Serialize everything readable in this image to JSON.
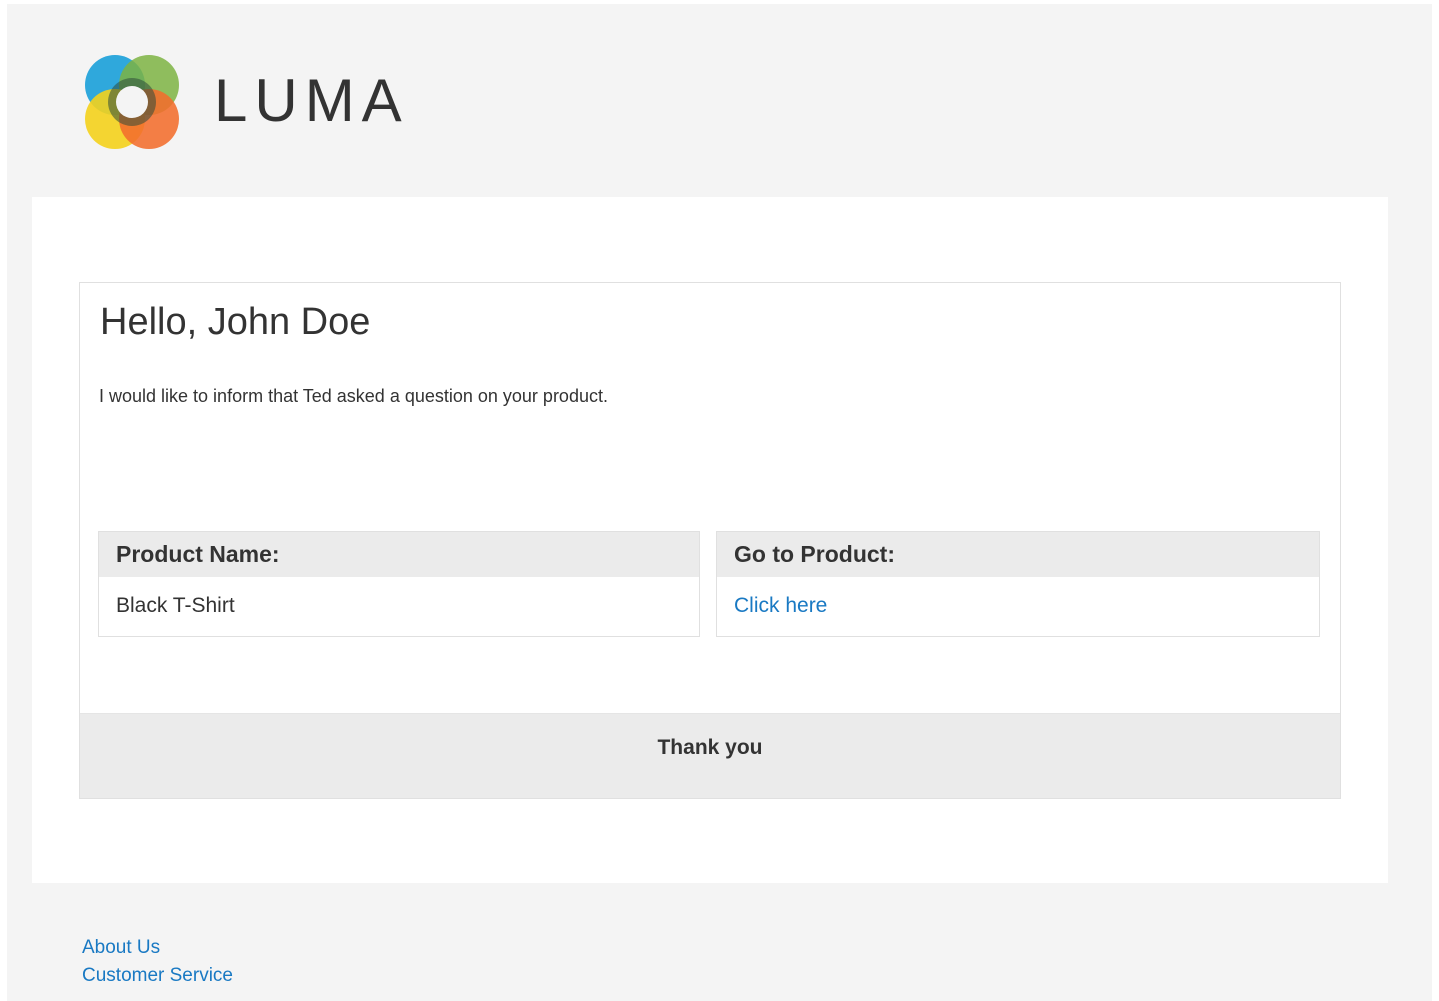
{
  "header": {
    "logo_text": "LUMA",
    "logo_icon": "luma-logo-icon"
  },
  "message": {
    "greeting": "Hello, John Doe",
    "intro": "I would like to inform that Ted asked a question on your product.",
    "product_name_label": "Product Name:",
    "product_name_value": "Black T-Shirt",
    "go_to_product_label": "Go to Product:",
    "go_to_product_link": "Click here",
    "thanks": "Thank you"
  },
  "footer": {
    "links": [
      "About Us",
      "Customer Service"
    ]
  },
  "colors": {
    "background": "#f4f4f4",
    "link": "#1979c3",
    "header_cell": "#ebebeb",
    "text": "#333333"
  }
}
